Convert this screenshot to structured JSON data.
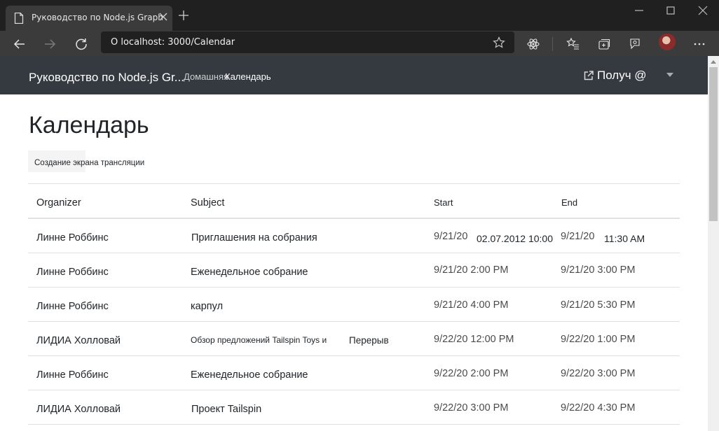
{
  "browser": {
    "tab_title": "Руководство по Node.js Graph",
    "address": "О localhost: 3000/Calendar"
  },
  "navbar": {
    "brand": "Руководство по Node.js Gr...",
    "home": "Домашняя",
    "calendar": "Календарь",
    "get": "Получ @"
  },
  "page": {
    "title": "Календарь",
    "stream_button": "Создание экрана трансляции"
  },
  "table": {
    "headers": [
      "Organizer",
      "Subject",
      "Start",
      "End"
    ],
    "rows": [
      {
        "organizer": "Линне Роббинс",
        "subject": "Приглашения на собрания",
        "subject_extra": "",
        "start": "9/21/20",
        "start_extra": "02.07.2012 10:00",
        "end": "9/21/20",
        "end_extra": "11:30 AM"
      },
      {
        "organizer": "Линне Роббинс",
        "subject": "Еженедельное собрание",
        "subject_extra": "",
        "start": "9/21/20 2:00 PM",
        "start_extra": "",
        "end": "9/21/20 3:00 PM",
        "end_extra": ""
      },
      {
        "organizer": "Линне Роббинс",
        "subject": "карпул",
        "subject_extra": "",
        "start": "9/21/20 4:00 PM",
        "start_extra": "",
        "end": "9/21/20 5:30 PM",
        "end_extra": ""
      },
      {
        "organizer": "ЛИДИА Холловай",
        "subject": "Обзор предложений Tailspin Toys и",
        "subject_extra": "Перерыв",
        "start": "9/22/20 12:00 PM",
        "start_extra": "",
        "end": "9/22/20 1:00 PM",
        "end_extra": ""
      },
      {
        "organizer": "Линне Роббинс",
        "subject": "Еженедельное собрание",
        "subject_extra": "",
        "start": "9/22/20 2:00 PM",
        "start_extra": "",
        "end": "9/22/20 3:00 PM",
        "end_extra": ""
      },
      {
        "organizer": "ЛИДИА Холловай",
        "subject": "Проект Tailspin",
        "subject_extra": "",
        "start": "9/22/20 3:00 PM",
        "start_extra": "",
        "end": "9/22/20 4:30 PM",
        "end_extra": ""
      }
    ]
  },
  "icons": {
    "page": "page-icon",
    "close": "close-icon",
    "new_tab": "plus-icon",
    "back": "back-arrow-icon",
    "forward": "forward-arrow-icon",
    "refresh": "refresh-icon",
    "favorite": "star-icon",
    "extension": "react-atom-icon",
    "favorites": "favorites-list-icon",
    "collections": "collections-icon",
    "feedback": "feedback-icon",
    "more": "more-icon",
    "external": "external-link-icon",
    "caret": "caret-down-icon"
  }
}
